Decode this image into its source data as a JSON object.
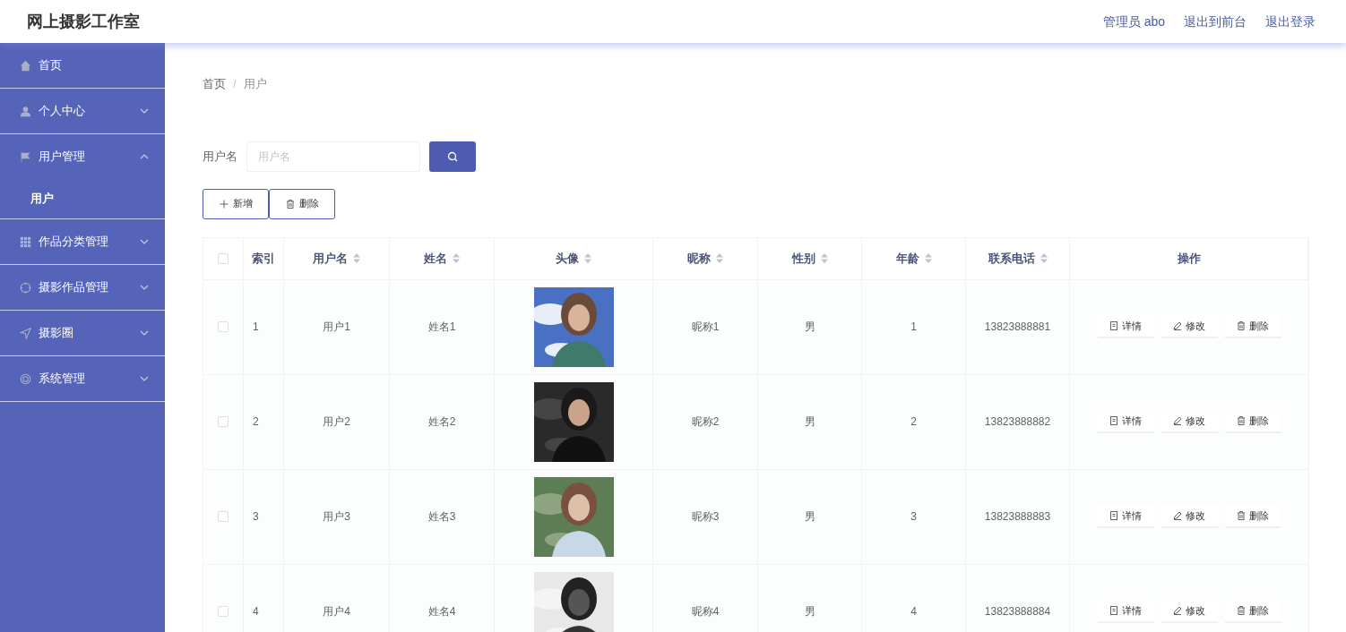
{
  "header": {
    "title": "网上摄影工作室",
    "links": [
      "管理员 abo",
      "退出到前台",
      "退出登录"
    ]
  },
  "sidebar": {
    "items": [
      {
        "label": "首页",
        "kind": "home",
        "has_arrow": false
      },
      {
        "label": "个人中心",
        "kind": "user",
        "expanded": false,
        "has_arrow": true
      },
      {
        "label": "用户管理",
        "kind": "flag",
        "expanded": true,
        "has_arrow": true,
        "children": [
          {
            "label": "用户"
          }
        ]
      },
      {
        "label": "作品分类管理",
        "kind": "grid",
        "expanded": false,
        "has_arrow": true
      },
      {
        "label": "摄影作品管理",
        "kind": "target",
        "expanded": false,
        "has_arrow": true
      },
      {
        "label": "摄影圈",
        "kind": "send",
        "expanded": false,
        "has_arrow": true
      },
      {
        "label": "系统管理",
        "kind": "ring",
        "expanded": false,
        "has_arrow": true
      }
    ]
  },
  "breadcrumb": {
    "items": [
      "首页",
      "用户"
    ],
    "separator": "/"
  },
  "search": {
    "label": "用户名",
    "placeholder": "用户名"
  },
  "toolbar": [
    {
      "kind": "add",
      "label": "新增"
    },
    {
      "kind": "delete",
      "label": "删除"
    }
  ],
  "table": {
    "select_all_checked": false,
    "columns": [
      {
        "label": "索引",
        "sortable": false
      },
      {
        "label": "用户名",
        "sortable": true
      },
      {
        "label": "姓名",
        "sortable": true
      },
      {
        "label": "头像",
        "sortable": true
      },
      {
        "label": "昵称",
        "sortable": true
      },
      {
        "label": "性别",
        "sortable": true
      },
      {
        "label": "年龄",
        "sortable": true
      },
      {
        "label": "联系电话",
        "sortable": true
      },
      {
        "label": "操作",
        "sortable": false
      }
    ],
    "rows": [
      {
        "checked": false,
        "index": "1",
        "username": "用户1",
        "name": "姓名1",
        "avatar": {
          "kind": "picture"
        },
        "nickname": "昵称1",
        "gender": "男",
        "age": "1",
        "phone": "13823888881",
        "actions": [
          {
            "kind": "detail",
            "label": "详情"
          },
          {
            "kind": "edit",
            "label": "修改"
          },
          {
            "kind": "delete",
            "label": "删除"
          }
        ]
      },
      {
        "checked": false,
        "index": "2",
        "username": "用户2",
        "name": "姓名2",
        "avatar": {
          "kind": "picture"
        },
        "nickname": "昵称2",
        "gender": "男",
        "age": "2",
        "phone": "13823888882",
        "actions": [
          {
            "kind": "detail",
            "label": "详情"
          },
          {
            "kind": "edit",
            "label": "修改"
          },
          {
            "kind": "delete",
            "label": "删除"
          }
        ]
      },
      {
        "checked": false,
        "index": "3",
        "username": "用户3",
        "name": "姓名3",
        "avatar": {
          "kind": "picture"
        },
        "nickname": "昵称3",
        "gender": "男",
        "age": "3",
        "phone": "13823888883",
        "actions": [
          {
            "kind": "detail",
            "label": "详情"
          },
          {
            "kind": "edit",
            "label": "修改"
          },
          {
            "kind": "delete",
            "label": "删除"
          }
        ]
      },
      {
        "checked": false,
        "index": "4",
        "username": "用户4",
        "name": "姓名4",
        "avatar": {
          "kind": "picture"
        },
        "nickname": "昵称4",
        "gender": "男",
        "age": "4",
        "phone": "13823888884",
        "actions": [
          {
            "kind": "detail",
            "label": "详情"
          },
          {
            "kind": "edit",
            "label": "修改"
          },
          {
            "kind": "delete",
            "label": "删除"
          }
        ]
      }
    ]
  }
}
